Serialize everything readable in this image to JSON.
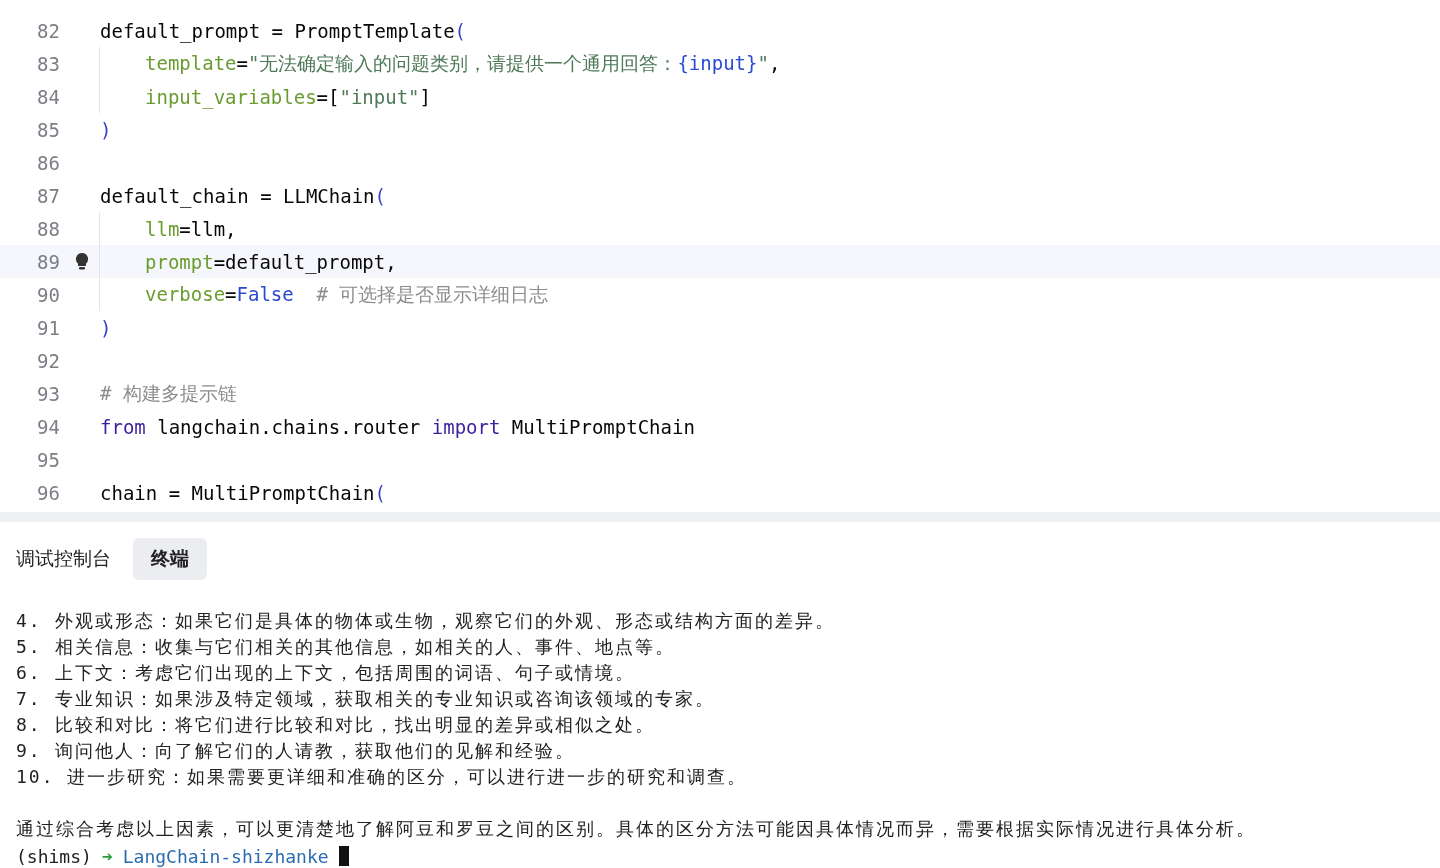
{
  "editor": {
    "lines": [
      {
        "number": "82",
        "indented": false,
        "current": false,
        "segments": [
          {
            "text": "default_prompt = PromptTemplate",
            "kind": "plain"
          },
          {
            "text": "(",
            "kind": "paren"
          }
        ]
      },
      {
        "number": "83",
        "indented": true,
        "current": false,
        "segments": [
          {
            "text": "template",
            "kind": "param"
          },
          {
            "text": "=",
            "kind": "plain"
          },
          {
            "text": "\"无法确定输入的问题类别，请提供一个通用回答：",
            "kind": "string"
          },
          {
            "text": "{input}",
            "kind": "constant"
          },
          {
            "text": "\"",
            "kind": "string"
          },
          {
            "text": ",",
            "kind": "plain"
          }
        ]
      },
      {
        "number": "84",
        "indented": true,
        "current": false,
        "segments": [
          {
            "text": "input_variables",
            "kind": "param"
          },
          {
            "text": "=[",
            "kind": "plain"
          },
          {
            "text": "\"input\"",
            "kind": "string"
          },
          {
            "text": "]",
            "kind": "plain"
          }
        ]
      },
      {
        "number": "85",
        "indented": false,
        "current": false,
        "segments": [
          {
            "text": ")",
            "kind": "paren"
          }
        ]
      },
      {
        "number": "86",
        "indented": false,
        "current": false
      },
      {
        "number": "87",
        "indented": false,
        "current": false,
        "segments": [
          {
            "text": "default_chain = LLMChain",
            "kind": "plain"
          },
          {
            "text": "(",
            "kind": "paren"
          }
        ]
      },
      {
        "number": "88",
        "indented": true,
        "current": false,
        "segments": [
          {
            "text": "llm",
            "kind": "param"
          },
          {
            "text": "=llm,",
            "kind": "plain"
          }
        ]
      },
      {
        "number": "89",
        "indented": true,
        "current": true,
        "segments": [
          {
            "text": "prompt",
            "kind": "param"
          },
          {
            "text": "=default_prompt,",
            "kind": "plain"
          }
        ]
      },
      {
        "number": "90",
        "indented": true,
        "current": false,
        "segments": [
          {
            "text": "verbose",
            "kind": "param"
          },
          {
            "text": "=",
            "kind": "plain"
          },
          {
            "text": "False",
            "kind": "constant"
          },
          {
            "text": "  # 可选择是否显示详细日志",
            "kind": "comment"
          }
        ]
      },
      {
        "number": "91",
        "indented": false,
        "current": false,
        "segments": [
          {
            "text": ")",
            "kind": "paren"
          }
        ]
      },
      {
        "number": "92",
        "indented": false,
        "current": false
      },
      {
        "number": "93",
        "indented": false,
        "current": false,
        "segments": [
          {
            "text": "# 构建多提示链",
            "kind": "comment"
          }
        ]
      },
      {
        "number": "94",
        "indented": false,
        "current": false,
        "segments": [
          {
            "text": "from",
            "kind": "keyword"
          },
          {
            "text": " langchain.chains.router ",
            "kind": "plain"
          },
          {
            "text": "import",
            "kind": "keyword"
          },
          {
            "text": " MultiPromptChain",
            "kind": "plain"
          }
        ]
      },
      {
        "number": "95",
        "indented": false,
        "current": false
      },
      {
        "number": "96",
        "indented": false,
        "current": false,
        "segments": [
          {
            "text": "chain = MultiPromptChain",
            "kind": "plain"
          },
          {
            "text": "(",
            "kind": "paren"
          }
        ]
      }
    ]
  },
  "panel_tabs": [
    {
      "label": "调试控制台",
      "selected": false
    },
    {
      "label": "终端",
      "selected": true
    }
  ],
  "terminal": {
    "lines": [
      "4. 外观或形态：如果它们是具体的物体或生物，观察它们的外观、形态或结构方面的差异。",
      "5. 相关信息：收集与它们相关的其他信息，如相关的人、事件、地点等。",
      "6. 上下文：考虑它们出现的上下文，包括周围的词语、句子或情境。",
      "7. 专业知识：如果涉及特定领域，获取相关的专业知识或咨询该领域的专家。",
      "8. 比较和对比：将它们进行比较和对比，找出明显的差异或相似之处。",
      "9. 询问他人：向了解它们的人请教，获取他们的见解和经验。",
      "10. 进一步研究：如果需要更详细和准确的区分，可以进行进一步的研究和调查。"
    ],
    "summary": "通过综合考虑以上因素，可以更清楚地了解阿豆和罗豆之间的区别。具体的区分方法可能因具体情况而异，需要根据实际情况进行具体分析。",
    "prompt": {
      "env": "(shims)",
      "arrow": "➜",
      "directory": "LangChain-shizhanke"
    }
  }
}
